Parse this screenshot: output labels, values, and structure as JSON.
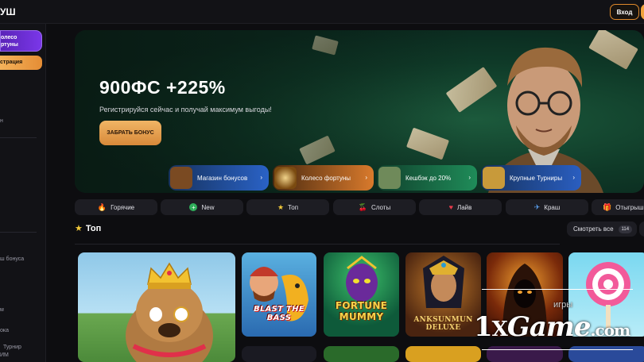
{
  "header": {
    "logo": "УШ",
    "login_label": "Вход"
  },
  "sidebar": {
    "wheel_button": "олесо\nртуны",
    "register_button": "страция",
    "items": [
      "н",
      "ш бонуса",
      "м",
      "ока",
      "Турнир",
      "ИМ"
    ]
  },
  "hero": {
    "title": "900ФС +225%",
    "subtitle": "Регистрируйся сейчас и получай максимум выгоды!",
    "button": "ЗАБРАТЬ БОНУС"
  },
  "promos": [
    {
      "label": "Магазин бонусов",
      "arrow": "›"
    },
    {
      "label": "Колесо фортуны",
      "arrow": "›"
    },
    {
      "label": "Кешбэк до 20%",
      "arrow": "›"
    },
    {
      "label": "Крупные Турниры",
      "arrow": "›"
    }
  ],
  "categories": [
    {
      "label": "Горячие",
      "icon": "🔥"
    },
    {
      "label": "New",
      "icon": "+"
    },
    {
      "label": "Топ",
      "icon": "★"
    },
    {
      "label": "Слоты",
      "icon": "🍒"
    },
    {
      "label": "Лайв",
      "icon": "♥"
    },
    {
      "label": "Краш",
      "icon": "✈"
    },
    {
      "label": "Отыгрыш",
      "icon": "🎁"
    }
  ],
  "section": {
    "title": "Топ",
    "see_all": "Смотреть все",
    "count": "114"
  },
  "games": [
    {
      "title": ""
    },
    {
      "title": "BLAST THE\nBASS"
    },
    {
      "title": "FORTUNE\nMUMMY"
    },
    {
      "title": "ANKSUNMUN\nDELUXE"
    },
    {
      "title": ""
    },
    {
      "title": ""
    }
  ],
  "watermark": {
    "small": "игры",
    "brand_1": "1",
    "brand_2": "X",
    "brand_3": "Game",
    "brand_4": ".com"
  },
  "colors": {
    "accent": "#f0a23c",
    "purple": "#7a37e8",
    "bg": "#0d0d10"
  }
}
